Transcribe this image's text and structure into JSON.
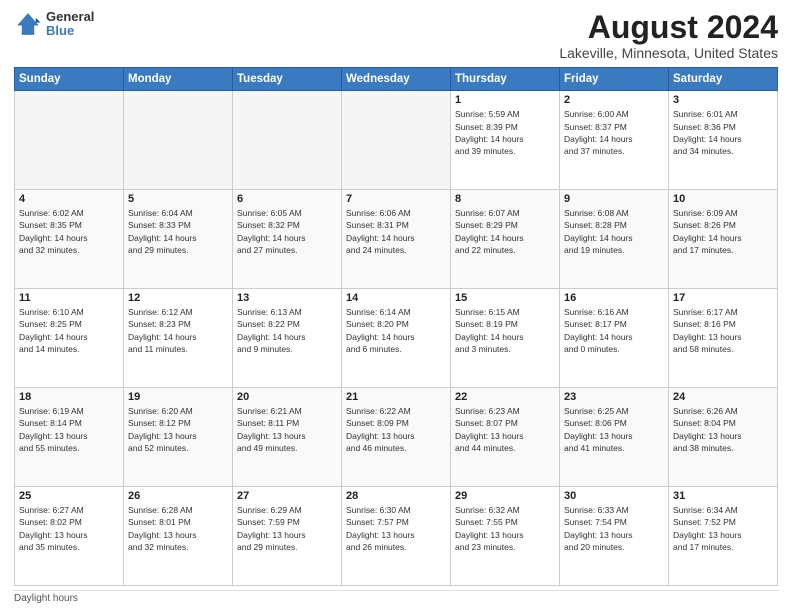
{
  "header": {
    "logo_line1": "General",
    "logo_line2": "Blue",
    "title": "August 2024",
    "subtitle": "Lakeville, Minnesota, United States"
  },
  "calendar": {
    "days_of_week": [
      "Sunday",
      "Monday",
      "Tuesday",
      "Wednesday",
      "Thursday",
      "Friday",
      "Saturday"
    ],
    "weeks": [
      [
        {
          "day": "",
          "detail": ""
        },
        {
          "day": "",
          "detail": ""
        },
        {
          "day": "",
          "detail": ""
        },
        {
          "day": "",
          "detail": ""
        },
        {
          "day": "1",
          "detail": "Sunrise: 5:59 AM\nSunset: 8:39 PM\nDaylight: 14 hours\nand 39 minutes."
        },
        {
          "day": "2",
          "detail": "Sunrise: 6:00 AM\nSunset: 8:37 PM\nDaylight: 14 hours\nand 37 minutes."
        },
        {
          "day": "3",
          "detail": "Sunrise: 6:01 AM\nSunset: 8:36 PM\nDaylight: 14 hours\nand 34 minutes."
        }
      ],
      [
        {
          "day": "4",
          "detail": "Sunrise: 6:02 AM\nSunset: 8:35 PM\nDaylight: 14 hours\nand 32 minutes."
        },
        {
          "day": "5",
          "detail": "Sunrise: 6:04 AM\nSunset: 8:33 PM\nDaylight: 14 hours\nand 29 minutes."
        },
        {
          "day": "6",
          "detail": "Sunrise: 6:05 AM\nSunset: 8:32 PM\nDaylight: 14 hours\nand 27 minutes."
        },
        {
          "day": "7",
          "detail": "Sunrise: 6:06 AM\nSunset: 8:31 PM\nDaylight: 14 hours\nand 24 minutes."
        },
        {
          "day": "8",
          "detail": "Sunrise: 6:07 AM\nSunset: 8:29 PM\nDaylight: 14 hours\nand 22 minutes."
        },
        {
          "day": "9",
          "detail": "Sunrise: 6:08 AM\nSunset: 8:28 PM\nDaylight: 14 hours\nand 19 minutes."
        },
        {
          "day": "10",
          "detail": "Sunrise: 6:09 AM\nSunset: 8:26 PM\nDaylight: 14 hours\nand 17 minutes."
        }
      ],
      [
        {
          "day": "11",
          "detail": "Sunrise: 6:10 AM\nSunset: 8:25 PM\nDaylight: 14 hours\nand 14 minutes."
        },
        {
          "day": "12",
          "detail": "Sunrise: 6:12 AM\nSunset: 8:23 PM\nDaylight: 14 hours\nand 11 minutes."
        },
        {
          "day": "13",
          "detail": "Sunrise: 6:13 AM\nSunset: 8:22 PM\nDaylight: 14 hours\nand 9 minutes."
        },
        {
          "day": "14",
          "detail": "Sunrise: 6:14 AM\nSunset: 8:20 PM\nDaylight: 14 hours\nand 6 minutes."
        },
        {
          "day": "15",
          "detail": "Sunrise: 6:15 AM\nSunset: 8:19 PM\nDaylight: 14 hours\nand 3 minutes."
        },
        {
          "day": "16",
          "detail": "Sunrise: 6:16 AM\nSunset: 8:17 PM\nDaylight: 14 hours\nand 0 minutes."
        },
        {
          "day": "17",
          "detail": "Sunrise: 6:17 AM\nSunset: 8:16 PM\nDaylight: 13 hours\nand 58 minutes."
        }
      ],
      [
        {
          "day": "18",
          "detail": "Sunrise: 6:19 AM\nSunset: 8:14 PM\nDaylight: 13 hours\nand 55 minutes."
        },
        {
          "day": "19",
          "detail": "Sunrise: 6:20 AM\nSunset: 8:12 PM\nDaylight: 13 hours\nand 52 minutes."
        },
        {
          "day": "20",
          "detail": "Sunrise: 6:21 AM\nSunset: 8:11 PM\nDaylight: 13 hours\nand 49 minutes."
        },
        {
          "day": "21",
          "detail": "Sunrise: 6:22 AM\nSunset: 8:09 PM\nDaylight: 13 hours\nand 46 minutes."
        },
        {
          "day": "22",
          "detail": "Sunrise: 6:23 AM\nSunset: 8:07 PM\nDaylight: 13 hours\nand 44 minutes."
        },
        {
          "day": "23",
          "detail": "Sunrise: 6:25 AM\nSunset: 8:06 PM\nDaylight: 13 hours\nand 41 minutes."
        },
        {
          "day": "24",
          "detail": "Sunrise: 6:26 AM\nSunset: 8:04 PM\nDaylight: 13 hours\nand 38 minutes."
        }
      ],
      [
        {
          "day": "25",
          "detail": "Sunrise: 6:27 AM\nSunset: 8:02 PM\nDaylight: 13 hours\nand 35 minutes."
        },
        {
          "day": "26",
          "detail": "Sunrise: 6:28 AM\nSunset: 8:01 PM\nDaylight: 13 hours\nand 32 minutes."
        },
        {
          "day": "27",
          "detail": "Sunrise: 6:29 AM\nSunset: 7:59 PM\nDaylight: 13 hours\nand 29 minutes."
        },
        {
          "day": "28",
          "detail": "Sunrise: 6:30 AM\nSunset: 7:57 PM\nDaylight: 13 hours\nand 26 minutes."
        },
        {
          "day": "29",
          "detail": "Sunrise: 6:32 AM\nSunset: 7:55 PM\nDaylight: 13 hours\nand 23 minutes."
        },
        {
          "day": "30",
          "detail": "Sunrise: 6:33 AM\nSunset: 7:54 PM\nDaylight: 13 hours\nand 20 minutes."
        },
        {
          "day": "31",
          "detail": "Sunrise: 6:34 AM\nSunset: 7:52 PM\nDaylight: 13 hours\nand 17 minutes."
        }
      ]
    ]
  },
  "footer": {
    "daylight_label": "Daylight hours"
  }
}
